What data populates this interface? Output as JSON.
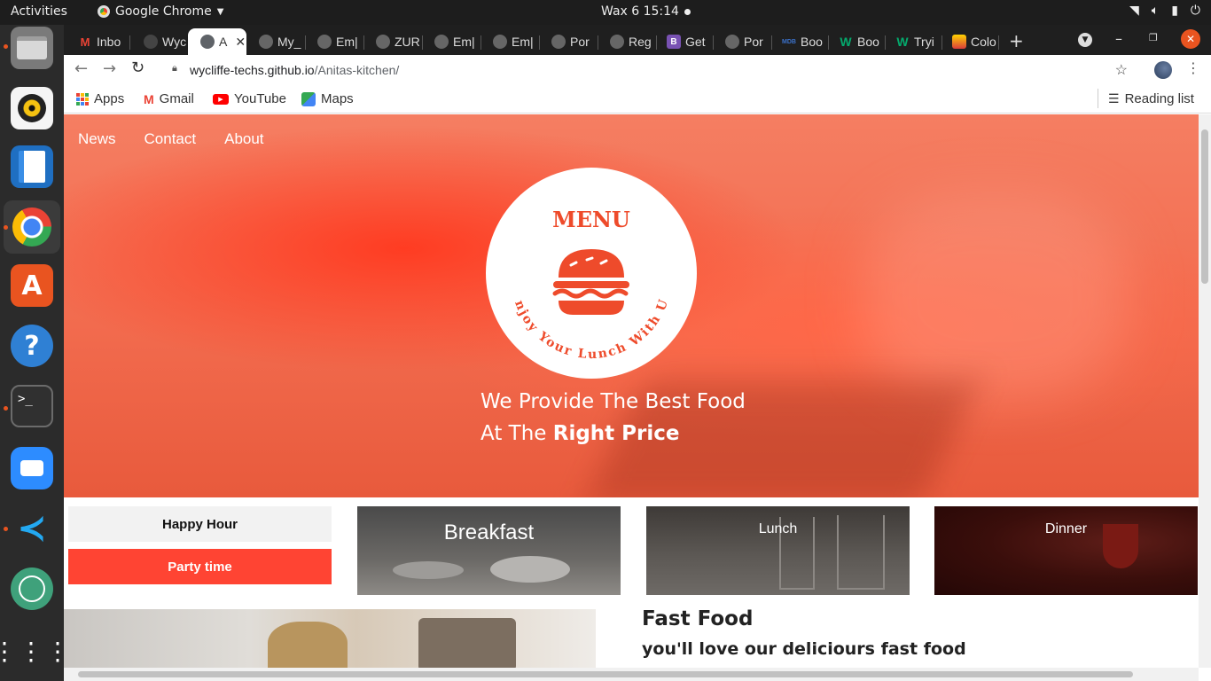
{
  "system_bar": {
    "activities": "Activities",
    "app_menu": "Google Chrome",
    "clock": "Wax 6  15:14",
    "tray_icons": [
      "wifi-icon",
      "volume-icon",
      "battery-icon",
      "power-icon"
    ]
  },
  "dock": {
    "items": [
      "files",
      "rhythmbox",
      "libreoffice-writer",
      "google-chrome",
      "ubuntu-software",
      "help",
      "terminal",
      "zoom",
      "vscode",
      "atom",
      "show-applications"
    ]
  },
  "tabs": [
    {
      "title": "Inbo",
      "icon": "gmail-icon"
    },
    {
      "title": "Wyc",
      "icon": "github-icon"
    },
    {
      "title": "A",
      "icon": "globe-icon",
      "active": true
    },
    {
      "title": "My_",
      "icon": "globe-icon"
    },
    {
      "title": "Em|",
      "icon": "globe-icon"
    },
    {
      "title": "ZUR",
      "icon": "globe-icon"
    },
    {
      "title": "Em|",
      "icon": "globe-icon"
    },
    {
      "title": "Em|",
      "icon": "globe-icon"
    },
    {
      "title": "Por",
      "icon": "globe-icon"
    },
    {
      "title": "Reg",
      "icon": "globe-icon"
    },
    {
      "title": "Get",
      "icon": "bootstrap-icon"
    },
    {
      "title": "Por",
      "icon": "globe-icon"
    },
    {
      "title": "Boo",
      "icon": "mdb-icon"
    },
    {
      "title": "Boo",
      "icon": "w-icon"
    },
    {
      "title": "Tryi",
      "icon": "w-icon"
    },
    {
      "title": "Colo",
      "icon": "colorzilla-icon"
    }
  ],
  "toolbar": {
    "url_host": "wycliffe-techs.github.io",
    "url_path": "/Anitas-kitchen/"
  },
  "bookmarks": {
    "items": [
      "Apps",
      "Gmail",
      "YouTube",
      "Maps"
    ],
    "reading_list": "Reading list"
  },
  "site": {
    "nav": [
      "News",
      "Contact",
      "About"
    ],
    "logo": {
      "title": "MENU",
      "slogan": "Enjoy Your Lunch With Us"
    },
    "tagline": {
      "line1": "We Provide The Best Food",
      "line2_prefix": "At The ",
      "line2_bold": "Right Price"
    },
    "buttons": {
      "happy_hour": "Happy Hour",
      "party_time": "Party time"
    },
    "cards": [
      "Breakfast",
      "Lunch",
      "Dinner"
    ],
    "fast_food": {
      "title": "Fast Food",
      "subtitle": "you'll love our deliciours fast food"
    }
  },
  "colors": {
    "accent": "#ff4433",
    "logo_red": "#ee4b2b",
    "hero_orange": "#f26b4e"
  }
}
